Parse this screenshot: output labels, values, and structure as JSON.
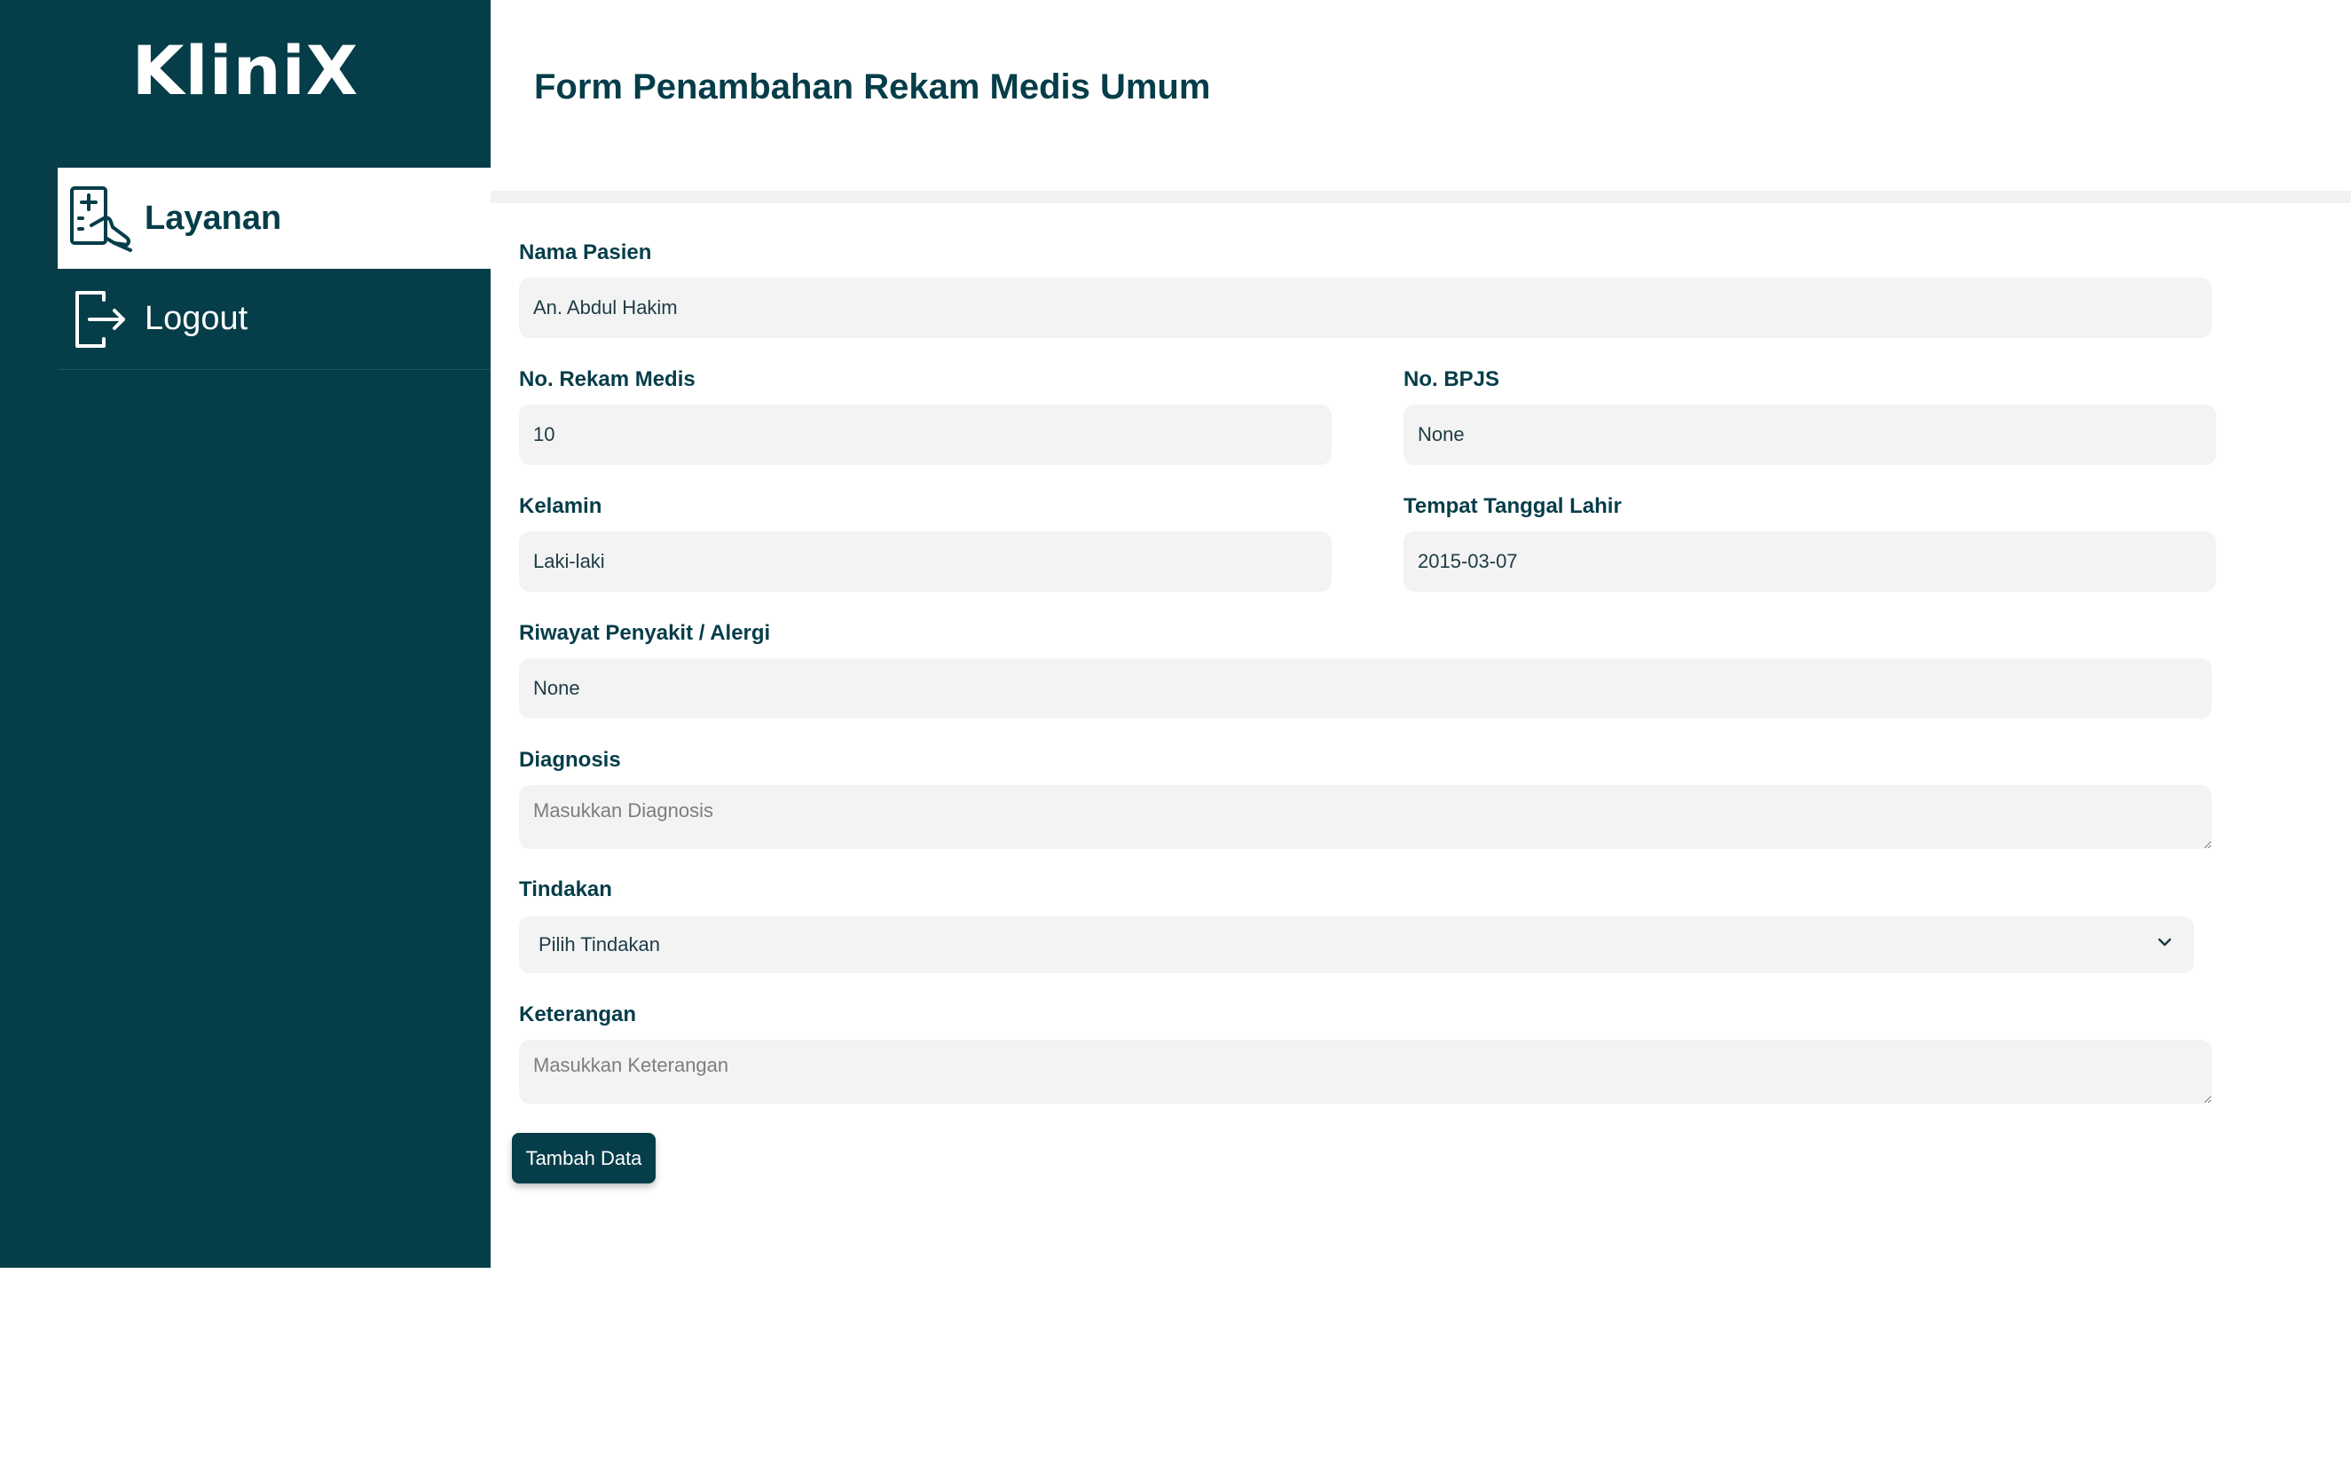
{
  "app": {
    "logo": "KliniX"
  },
  "sidebar": {
    "items": [
      {
        "label": "Layanan",
        "icon": "medical-record-icon",
        "active": true
      },
      {
        "label": "Logout",
        "icon": "logout-icon",
        "active": false
      }
    ]
  },
  "page": {
    "title": "Form Penambahan Rekam Medis Umum"
  },
  "form": {
    "nama_pasien": {
      "label": "Nama Pasien",
      "value": "An. Abdul Hakim"
    },
    "no_rekam_medis": {
      "label": "No. Rekam Medis",
      "value": "10"
    },
    "no_bpjs": {
      "label": "No. BPJS",
      "value": "None"
    },
    "kelamin": {
      "label": "Kelamin",
      "value": "Laki-laki"
    },
    "ttl": {
      "label": "Tempat Tanggal Lahir",
      "value": "2015-03-07"
    },
    "riwayat": {
      "label": "Riwayat Penyakit / Alergi",
      "value": "None"
    },
    "diagnosis": {
      "label": "Diagnosis",
      "value": "",
      "placeholder": "Masukkan Diagnosis"
    },
    "tindakan": {
      "label": "Tindakan",
      "selected": "Pilih Tindakan"
    },
    "keterangan": {
      "label": "Keterangan",
      "value": "",
      "placeholder": "Masukkan Keterangan"
    },
    "submit_label": "Tambah Data"
  },
  "colors": {
    "primary": "#053d49",
    "field_bg": "#f3f3f3",
    "divider": "#f2f2f2"
  }
}
